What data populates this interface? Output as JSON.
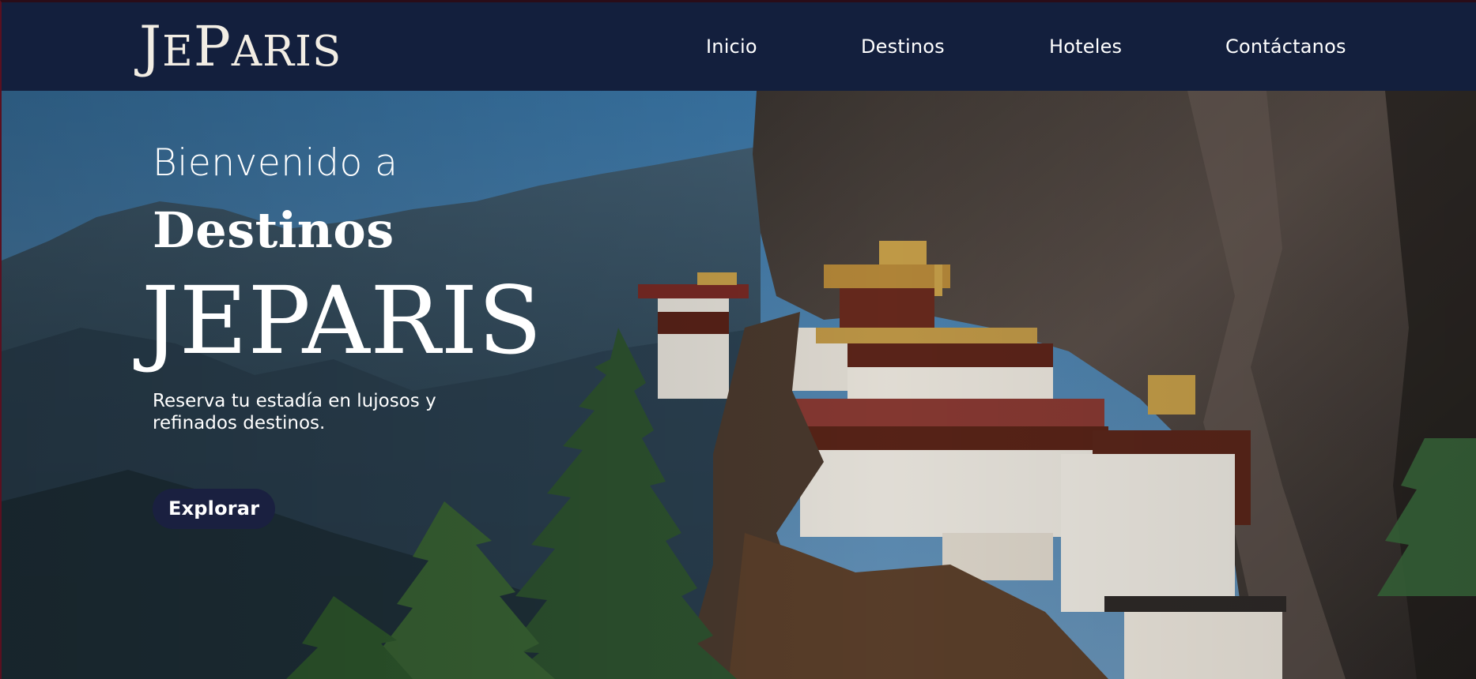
{
  "navbar": {
    "logo_first_letter": "J",
    "logo_mid": "E",
    "logo_p": "P",
    "logo_rest": "ARIS",
    "links": [
      "Inicio",
      "Destinos",
      "Hoteles",
      "Contáctanos"
    ]
  },
  "hero": {
    "welcome": "Bienvenido a",
    "destinos": "Destinos",
    "brand": "JEPARIS",
    "subtitle_line1": "Reserva tu estadía en lujosos y",
    "subtitle_line2": "refinados destinos.",
    "cta_label": "Explorar",
    "background": "Monasterio en acantilado con bosque de pinos"
  },
  "colors": {
    "navbar_bg": "#131f3d",
    "text": "#ffffff",
    "cta_bg": "#1a2040"
  }
}
